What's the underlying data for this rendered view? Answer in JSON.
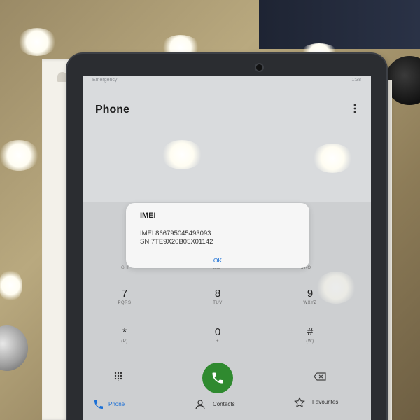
{
  "scene": {
    "description_colors": {
      "counter": "#a89a72",
      "tablet_frame": "#2b2d31",
      "screen": "#d9dbdd",
      "call_green": "#2f8a2f",
      "accent_blue": "#1a6fd6"
    }
  },
  "status": {
    "left": "Emergency",
    "right": "1:38"
  },
  "app": {
    "title": "Phone"
  },
  "dialog": {
    "title": "IMEI",
    "imei": "IMEI:866795045493093",
    "sn": "SN:7TE9X20B05X01142",
    "ok_label": "OK"
  },
  "ghost_labels": {
    "ghi": "GHI",
    "jkl": "JKL",
    "mno": "MNO"
  },
  "keypad": [
    {
      "digit": "7",
      "letters": "PQRS"
    },
    {
      "digit": "8",
      "letters": "TUV"
    },
    {
      "digit": "9",
      "letters": "WXYZ"
    },
    {
      "digit": "*",
      "letters": "(P)"
    },
    {
      "digit": "0",
      "letters": "+"
    },
    {
      "digit": "#",
      "letters": "(W)"
    }
  ],
  "tabs": {
    "phone": "Phone",
    "contacts": "Contacts",
    "favourites": "Favourites"
  },
  "icons": {
    "menu": "more-vert-icon",
    "dialpad": "dialpad-icon",
    "call": "call-icon",
    "backspace": "backspace-icon"
  }
}
